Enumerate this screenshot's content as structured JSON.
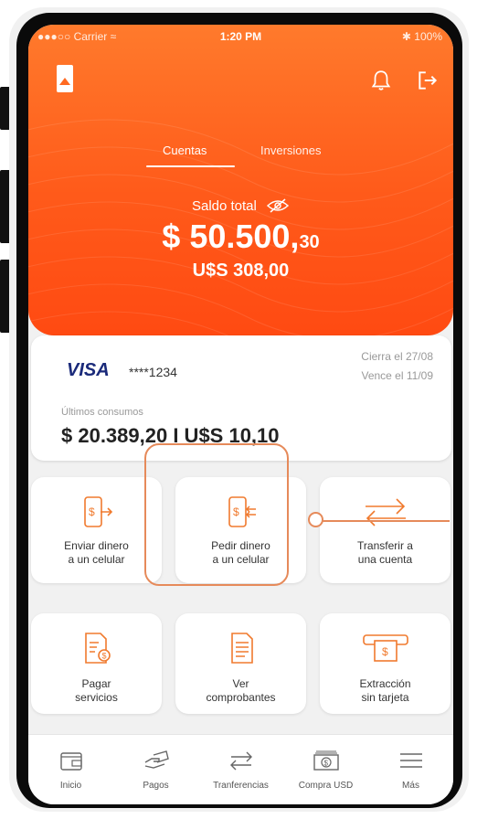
{
  "status_bar": {
    "carrier": "●●●○○ Carrier ≈",
    "time": "1:20 PM",
    "battery": "✱ 100%"
  },
  "header": {
    "tabs": [
      {
        "label": "Cuentas",
        "active": true
      },
      {
        "label": "Inversiones",
        "active": false
      }
    ],
    "balance_label": "Saldo total",
    "balance_main": "$ 50.500,",
    "balance_cents": "30",
    "balance_usd": "U$S 308,00",
    "icons": {
      "logo": "bank-logo",
      "notifications": "bell-icon",
      "logout": "logout-icon",
      "visibility": "eye-slash-icon"
    },
    "colors": {
      "top": "#ff7a2c",
      "bottom": "#ff4a12"
    }
  },
  "card": {
    "brand": "VISA",
    "number": "****1234",
    "closes": "Cierra el 27/08",
    "due": "Vence el 11/09",
    "last_label": "Últimos consumos",
    "last_amount": "$ 20.389,20  I  U$S 10,10"
  },
  "actions": [
    {
      "line1": "Enviar dinero",
      "line2": "a un celular",
      "icon": "send-money-phone-icon"
    },
    {
      "line1": "Pedir dinero",
      "line2": "a un celular",
      "icon": "request-money-phone-icon"
    },
    {
      "line1": "Transferir a",
      "line2": "una cuenta",
      "icon": "transfer-arrows-icon"
    },
    {
      "line1": "Pagar",
      "line2": "servicios",
      "icon": "pay-bills-icon"
    },
    {
      "line1": "Ver",
      "line2": "comprobantes",
      "icon": "receipts-icon"
    },
    {
      "line1": "Extracción",
      "line2": "sin tarjeta",
      "icon": "cardless-withdrawal-icon"
    }
  ],
  "nav": [
    {
      "label": "Inicio",
      "icon": "wallet-icon"
    },
    {
      "label": "Pagos",
      "icon": "payment-hand-icon"
    },
    {
      "label": "Tranferencias",
      "icon": "transfer-icon"
    },
    {
      "label": "Compra USD",
      "icon": "dollar-bill-icon"
    },
    {
      "label": "Más",
      "icon": "menu-icon"
    }
  ],
  "accent_color": "#f07a2e"
}
